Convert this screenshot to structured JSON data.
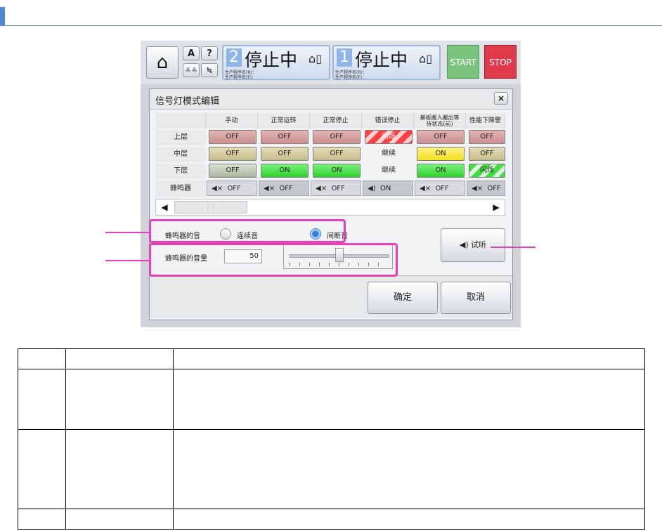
{
  "header": {
    "home_icon": "home-icon",
    "small_buttons": [
      "A",
      "?"
    ],
    "lanes": [
      {
        "number": "2",
        "status": "停止中",
        "info1": "生产程序名(R)：",
        "info2": "生产程序名(F)："
      },
      {
        "number": "1",
        "status": "停止中",
        "info1": "生产程序名(R)：",
        "info2": "生产程序名(F)："
      }
    ],
    "start_label": "START",
    "stop_label": "STOP"
  },
  "dialog": {
    "title": "信号灯模式编辑",
    "close_label": "×",
    "columns": [
      "手动",
      "正常运转",
      "正常停止",
      "错误停止",
      "基板搬入搬出等\n待状态(前)",
      "性能下降警"
    ],
    "rows": [
      {
        "label": "上层",
        "cells": [
          "OFF",
          "OFF",
          "OFF",
          "闪烁",
          "OFF",
          "OFF"
        ]
      },
      {
        "label": "中层",
        "cells": [
          "OFF",
          "OFF",
          "OFF",
          "继续",
          "ON",
          "OFF"
        ]
      },
      {
        "label": "下层",
        "cells": [
          "OFF",
          "ON",
          "ON",
          "继续",
          "ON",
          "闪烁"
        ]
      },
      {
        "label": "蜂鸣器",
        "cells": [
          "OFF",
          "OFF",
          "OFF",
          "ON",
          "OFF",
          "OFF"
        ]
      }
    ],
    "buzzer_sound_label": "蜂鸣器的音",
    "radio_options": [
      "连续音",
      "间断音"
    ],
    "radio_selected": "间断音",
    "volume_label": "蜂鸣器的音量",
    "volume_value": "50",
    "volume_level": 0.5,
    "listen_label": "试听",
    "ok_label": "确定",
    "cancel_label": "取消"
  },
  "colors": {
    "accent": "#4f88d3",
    "highlight": "#e640b6",
    "start": "#7cc47e",
    "stop": "#e03a4b"
  }
}
